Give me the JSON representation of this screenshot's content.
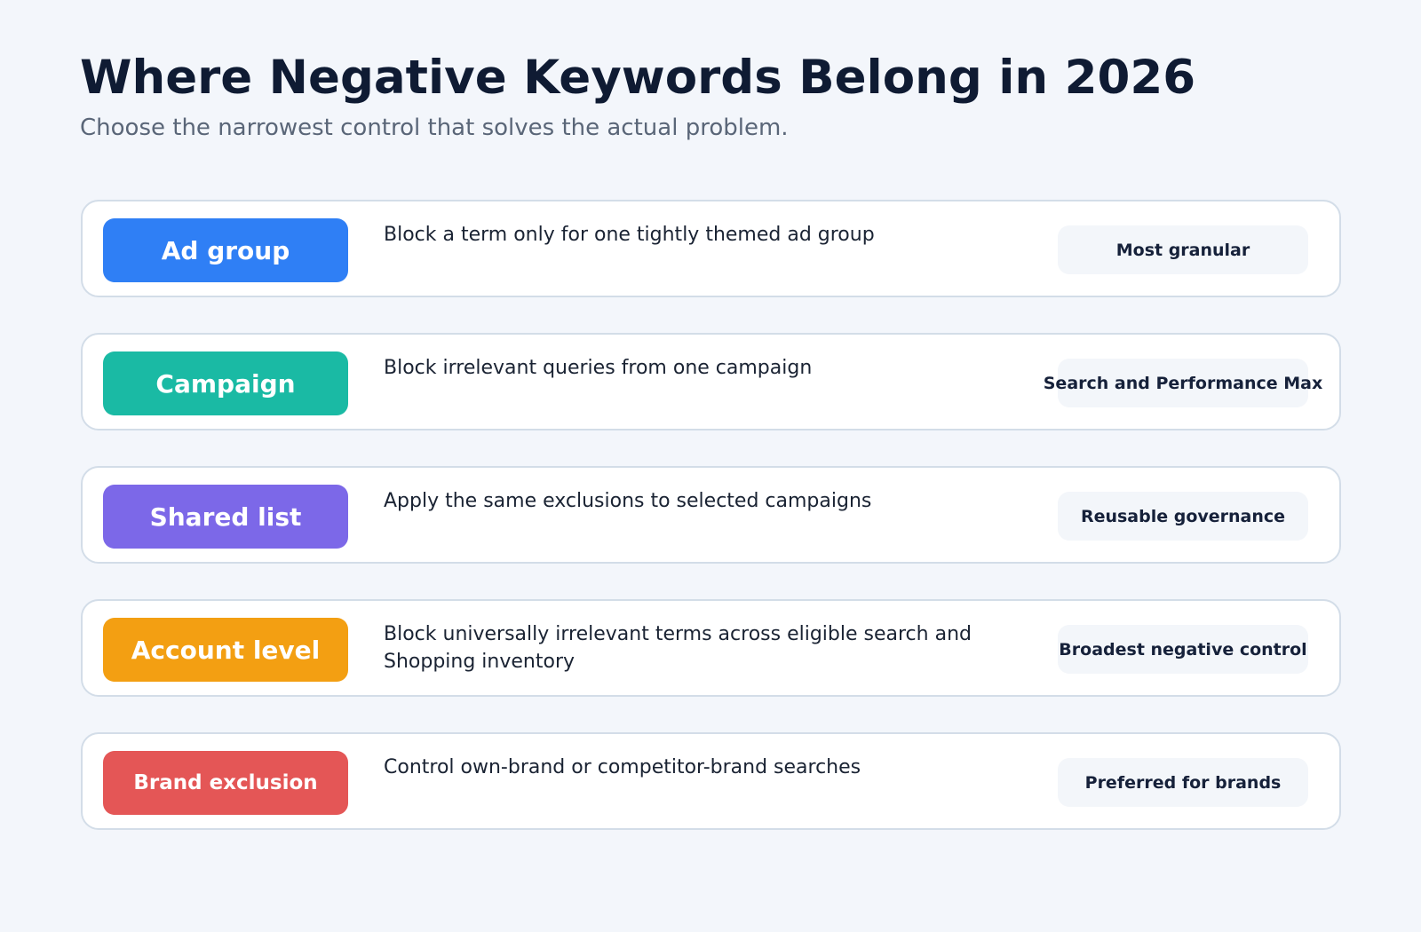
{
  "title": "Where Negative Keywords Belong in 2026",
  "subtitle": "Choose the narrowest control that solves the actual problem.",
  "rows": [
    {
      "label": "Ad group",
      "color": "#2f7ff5",
      "description": "Block a term only for one tightly themed ad group",
      "scope": "Most granular"
    },
    {
      "label": "Campaign",
      "color": "#1abaa4",
      "description": "Block irrelevant queries from one campaign",
      "scope": "Search and Performance Max"
    },
    {
      "label": "Shared list",
      "color": "#7c68e8",
      "description": "Apply the same exclusions to selected campaigns",
      "scope": "Reusable governance"
    },
    {
      "label": "Account level",
      "color": "#f39f12",
      "description": "Block universally irrelevant terms across eligible search and Shopping inventory",
      "scope": "Broadest negative control"
    },
    {
      "label": "Brand exclusion",
      "color": "#e45656",
      "description": "Control own-brand or competitor-brand searches",
      "scope": "Preferred for brands"
    }
  ]
}
